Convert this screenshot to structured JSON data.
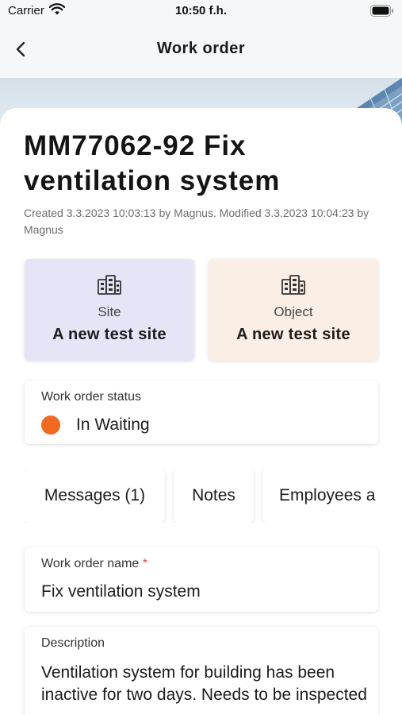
{
  "status_bar": {
    "carrier": "Carrier",
    "time": "10:50 f.h."
  },
  "nav": {
    "title": "Work order",
    "back_icon": "chevron-left-icon"
  },
  "work_order": {
    "title": "MM77062-92 Fix ventilation system",
    "meta": "Created 3.3.2023 10:03:13 by Magnus. Modified 3.3.2023 10:04:23 by Magnus"
  },
  "tiles": [
    {
      "label": "Site",
      "value": "A new test site",
      "icon": "building-icon",
      "color": "#e6e4f7"
    },
    {
      "label": "Object",
      "value": "A new test site",
      "icon": "building-icon",
      "color": "#fbeee4"
    }
  ],
  "status": {
    "label": "Work order status",
    "value": "In Waiting",
    "color": "#f26a21"
  },
  "tabs": [
    "Messages (1)",
    "Notes",
    "Employees a"
  ],
  "name_field": {
    "label": "Work order name",
    "required": "*",
    "value": "Fix ventilation system"
  },
  "description": {
    "label": "Description",
    "value": "Ventilation system for building has been inactive for two days. Needs to be inspected"
  }
}
